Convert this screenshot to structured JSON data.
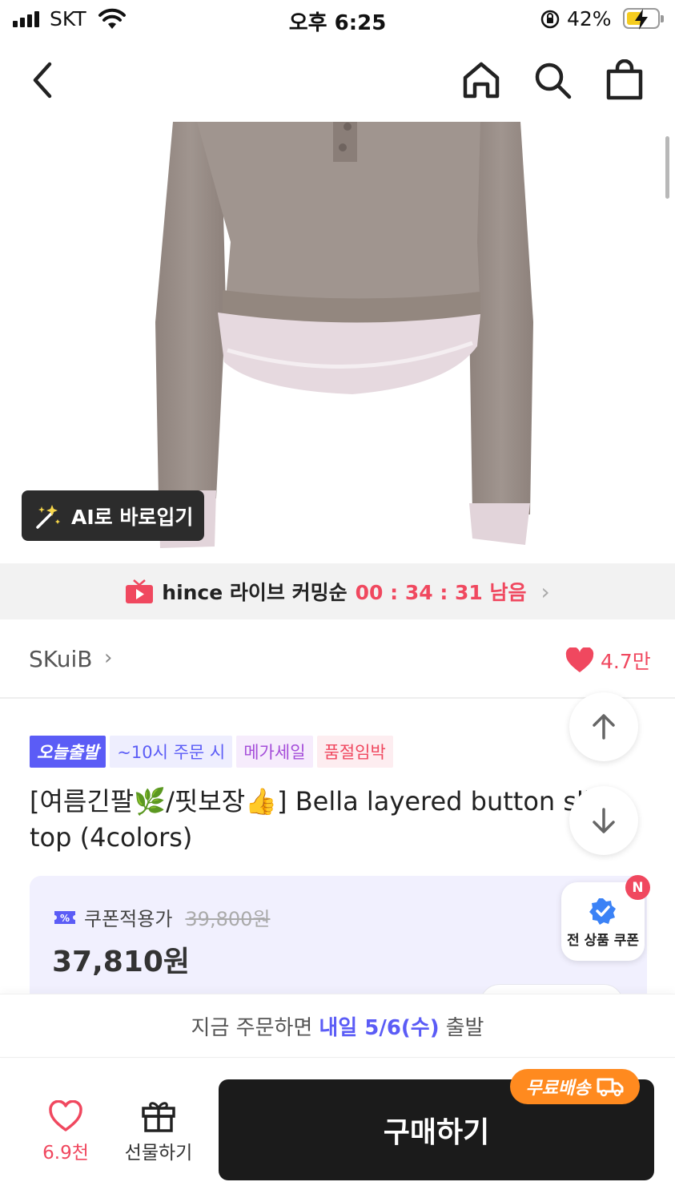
{
  "status_bar": {
    "carrier": "SKT",
    "time": "오후 6:25",
    "battery_percent": "42%"
  },
  "nav": {
    "back_icon": "chevron-left-icon",
    "home_icon": "home-icon",
    "search_icon": "search-icon",
    "cart_icon": "shopping-bag-icon"
  },
  "ai_try_on": {
    "label": "AI로 바로입기"
  },
  "live_banner": {
    "text": "hince 라이브 커밍순",
    "timer": "00 : 34 : 31 남음"
  },
  "brand": {
    "name": "SKuiB",
    "likes": "4.7만"
  },
  "badges": {
    "today_ship": "오늘출발",
    "order_time": "~10시 주문 시",
    "mega_sale": "메가세일",
    "sold_out_soon": "품절임박"
  },
  "product": {
    "title_line1": "[여름긴팔🌿/핏보장👍] Bella layered button sli",
    "title_line2": "top (4colors)"
  },
  "price": {
    "coupon_label": "쿠폰적용가",
    "original": "39,800원",
    "final": "37,810원"
  },
  "coupon_fab": {
    "label": "전 상품 쿠폰",
    "new_badge": "N"
  },
  "shipping": {
    "prefix": "지금 주문하면",
    "highlight": "내일 5/6(수)",
    "suffix": "출발"
  },
  "bottom_bar": {
    "wish_count": "6.9천",
    "gift_label": "선물하기",
    "buy_label": "구매하기",
    "free_shipping": "무료배송"
  },
  "colors": {
    "accent": "#5b5cf6",
    "like_red": "#f0485f",
    "free_ship_orange": "#ff8a1f",
    "buy_button": "#1b1b1b",
    "product_body": "#9c9089",
    "product_hem": "#e3d5dc"
  }
}
